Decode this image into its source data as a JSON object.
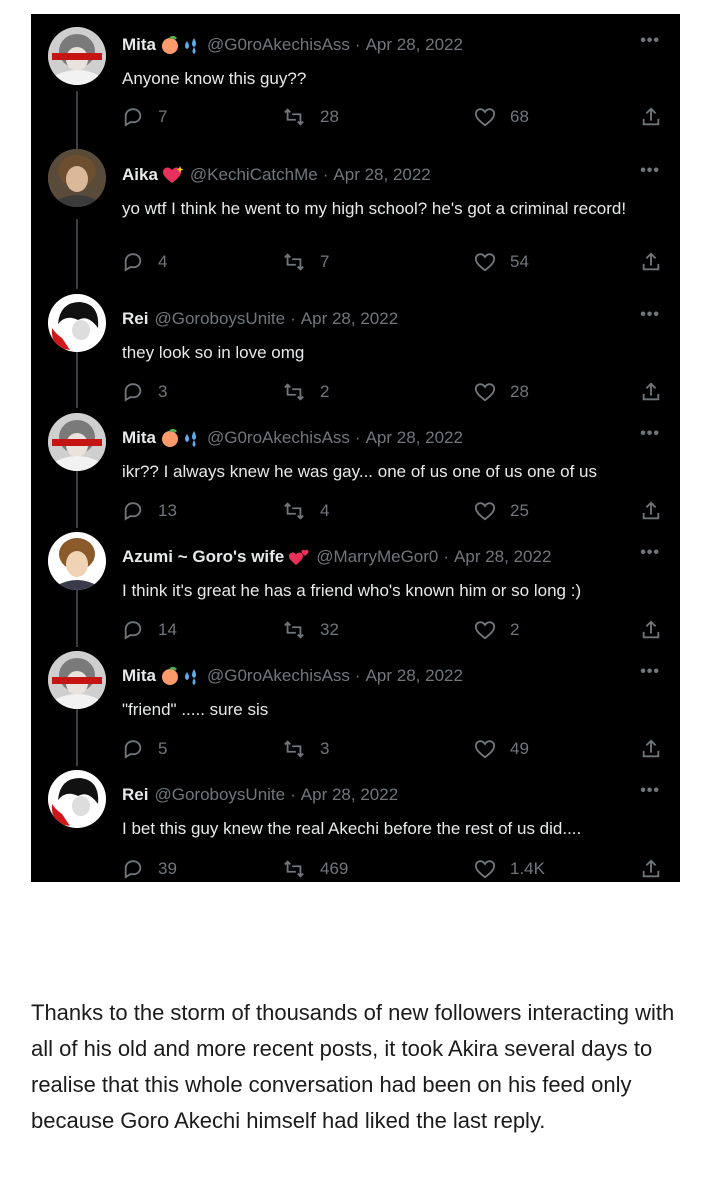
{
  "colors": {
    "background": "#000000",
    "text": "#e7e9ea",
    "muted": "#71767b"
  },
  "tweets": [
    {
      "name": "Mita",
      "emoji": [
        "peach-emoji",
        "sweat-droplets-emoji"
      ],
      "handle": "@G0roAkechisAss",
      "date": "Apr 28, 2022",
      "text": "Anyone know this guy??",
      "replies": "7",
      "retweets": "28",
      "likes": "68"
    },
    {
      "name": "Aika",
      "emoji": [
        "sparkling-heart-emoji"
      ],
      "handle": "@KechiCatchMe",
      "date": "Apr 28, 2022",
      "text": "yo wtf I think he went to my high school? he's got a criminal record!",
      "replies": "4",
      "retweets": "7",
      "likes": "54"
    },
    {
      "name": "Rei",
      "emoji": [],
      "handle": "@GoroboysUnite",
      "date": "Apr 28, 2022",
      "text": "they look so in love omg",
      "replies": "3",
      "retweets": "2",
      "likes": "28"
    },
    {
      "name": "Mita",
      "emoji": [
        "peach-emoji",
        "sweat-droplets-emoji"
      ],
      "handle": "@G0roAkechisAss",
      "date": "Apr 28, 2022",
      "text": "ikr?? I always knew he was gay... one of us one of us one of us",
      "replies": "13",
      "retweets": "4",
      "likes": "25"
    },
    {
      "name": "Azumi ~ Goro's wife",
      "emoji": [
        "two-hearts-emoji"
      ],
      "handle": "@MarryMeGor0",
      "date": "Apr 28, 2022",
      "text": "I think it's great he has a friend who's known him or so long :)",
      "replies": "14",
      "retweets": "32",
      "likes": "2"
    },
    {
      "name": "Mita",
      "emoji": [
        "peach-emoji",
        "sweat-droplets-emoji"
      ],
      "handle": "@G0roAkechisAss",
      "date": "Apr 28, 2022",
      "text": "\"friend\" ..... sure sis",
      "replies": "5",
      "retweets": "3",
      "likes": "49"
    },
    {
      "name": "Rei",
      "emoji": [],
      "handle": "@GoroboysUnite",
      "date": "Apr 28, 2022",
      "text": "I bet this guy knew the real Akechi before the rest of us did....",
      "replies": "39",
      "retweets": "469",
      "likes": "1.4K"
    }
  ],
  "separator": "·",
  "story_text": "Thanks to the storm of thousands of new followers interacting with all of his old and more recent posts, it took Akira several days to realise that this whole conversation had been on his feed only because Goro Akechi himself had liked the last reply."
}
